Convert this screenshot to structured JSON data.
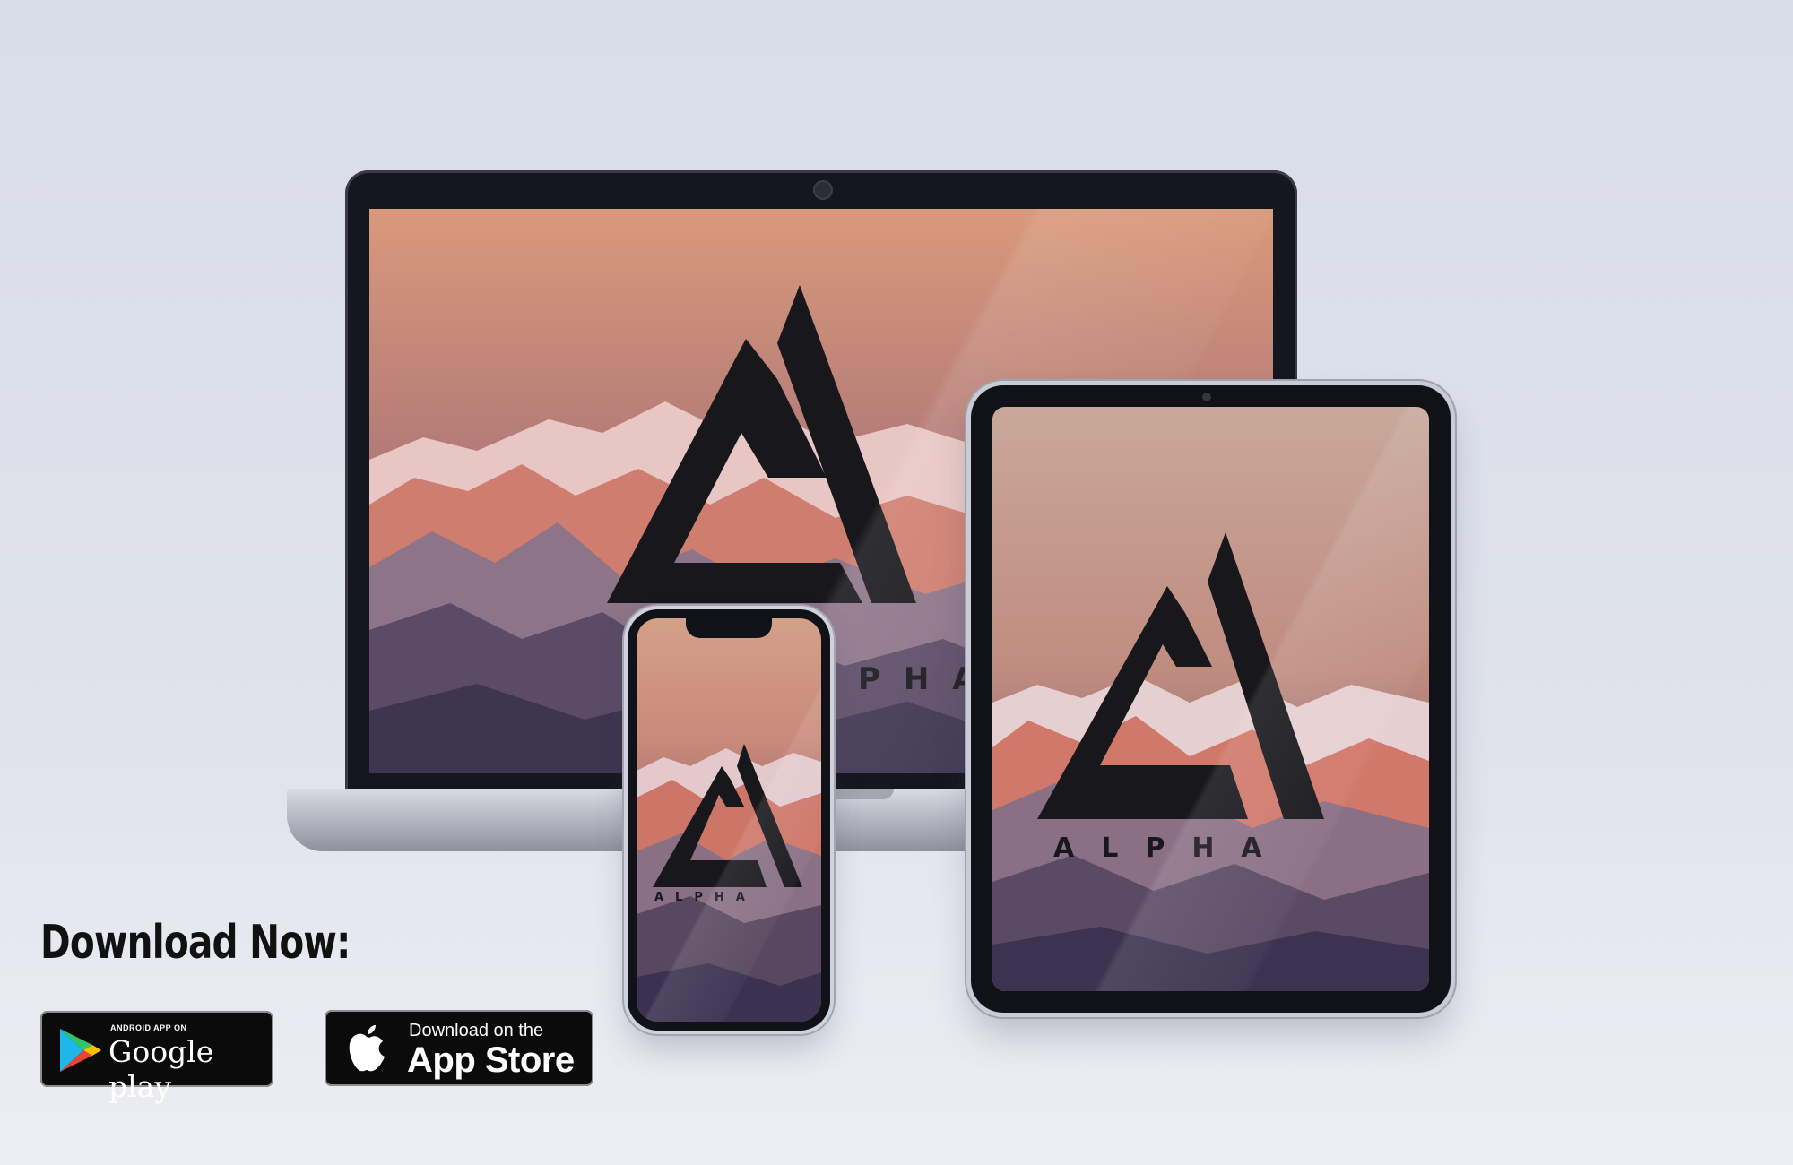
{
  "brand": {
    "wordmark": "ALPHA",
    "laptop_wordmark_visible": "PHA",
    "logo_color": "#17171c"
  },
  "download": {
    "heading": "Download Now:",
    "google_play": {
      "small_label": "ANDROID APP ON",
      "big_label": "Google play",
      "icon": "google-play-triangle-icon"
    },
    "app_store": {
      "small_label": "Download on the",
      "big_label": "App Store",
      "icon": "apple-logo-icon"
    }
  },
  "colors": {
    "background": "#dcdfe9",
    "sky_top": "#d89a7e",
    "sky_bottom": "#7a6a8a",
    "mountain_glow": "#e0735a",
    "snow": "#e9dfe6",
    "badge_bg": "#0b0b0b"
  }
}
